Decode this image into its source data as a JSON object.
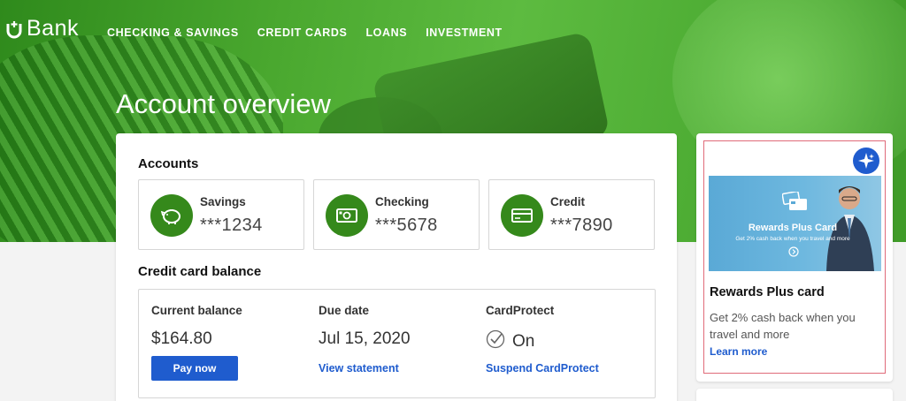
{
  "brand": {
    "name": "Bank",
    "color": "#35891b",
    "accent": "#1f5cce"
  },
  "nav": {
    "items": [
      "CHECKING & SAVINGS",
      "CREDIT CARDS",
      "LOANS",
      "INVESTMENT"
    ]
  },
  "page": {
    "title": "Account overview"
  },
  "accounts": {
    "title": "Accounts",
    "items": [
      {
        "label": "Savings",
        "number": "***1234",
        "icon": "piggy-bank-icon"
      },
      {
        "label": "Checking",
        "number": "***5678",
        "icon": "cash-icon"
      },
      {
        "label": "Credit",
        "number": "***7890",
        "icon": "credit-card-icon"
      }
    ]
  },
  "credit_balance": {
    "title": "Credit card balance",
    "current_label": "Current balance",
    "current_value": "$164.80",
    "due_label": "Due date",
    "due_value": "Jul 15, 2020",
    "protect_label": "CardProtect",
    "protect_value": "On",
    "pay_button": "Pay now",
    "view_statement": "View statement",
    "suspend": "Suspend CardProtect"
  },
  "promo": {
    "image_title": "Rewards Plus Card",
    "image_subtitle": "Get 2% cash back when you travel and more",
    "title": "Rewards Plus card",
    "description": "Get 2% cash back when you travel and more",
    "link": "Learn more"
  }
}
